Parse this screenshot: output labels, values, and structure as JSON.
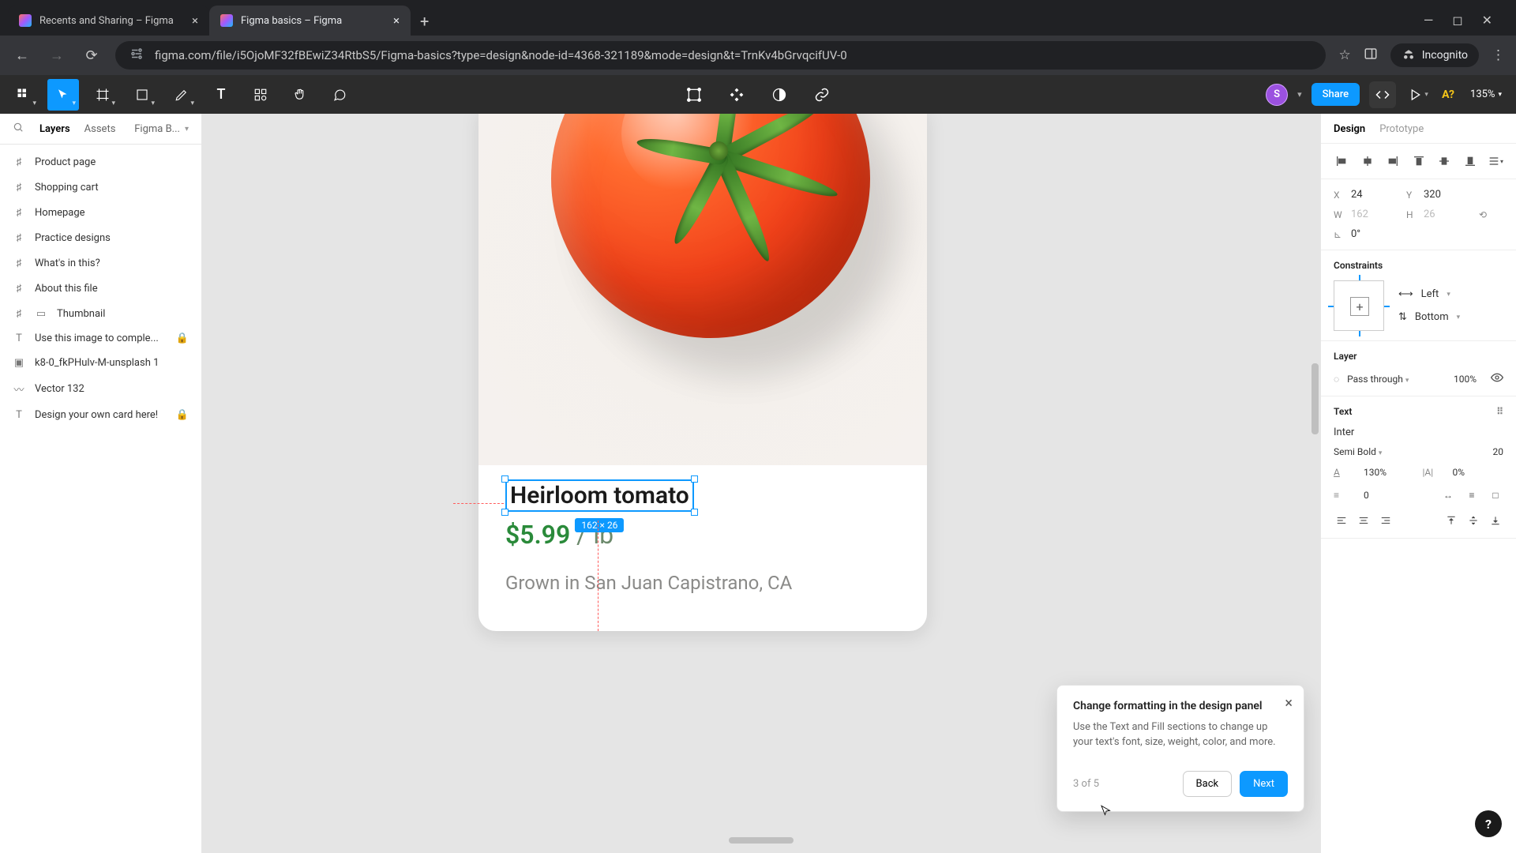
{
  "browser": {
    "tabs": [
      {
        "title": "Recents and Sharing – Figma",
        "active": false
      },
      {
        "title": "Figma basics – Figma",
        "active": true
      }
    ],
    "url": "figma.com/file/i5OjoMF32fBEwiZ34RtbS5/Figma-basics?type=design&node-id=4368-321189&mode=design&t=TrnKv4bGrvqcifUV-0",
    "incognito_label": "Incognito"
  },
  "toolbar": {
    "avatar_initial": "S",
    "share_label": "Share",
    "zoom": "135%"
  },
  "left_panel": {
    "header": {
      "layers": "Layers",
      "assets": "Assets",
      "page": "Figma B..."
    },
    "items": [
      {
        "icon": "frame-icon",
        "label": "Product page"
      },
      {
        "icon": "frame-icon",
        "label": "Shopping cart"
      },
      {
        "icon": "frame-icon",
        "label": "Homepage"
      },
      {
        "icon": "frame-icon",
        "label": "Practice designs"
      },
      {
        "icon": "frame-icon",
        "label": "What's in this?"
      },
      {
        "icon": "frame-icon",
        "label": "About this file"
      },
      {
        "icon": "frame-icon",
        "label": "Thumbnail",
        "thumb": true
      },
      {
        "icon": "text-icon",
        "label": "Use this image to comple...",
        "locked": true
      },
      {
        "icon": "image-icon",
        "label": "k8-0_fkPHulv-M-unsplash 1"
      },
      {
        "icon": "vector-icon",
        "label": "Vector 132"
      },
      {
        "icon": "text-icon",
        "label": "Design your own card here!",
        "locked": true
      }
    ]
  },
  "canvas": {
    "title": "Heirloom tomato",
    "price": "$5.99",
    "per": "/ lb",
    "origin": "Grown in San Juan Capistrano, CA",
    "selection_badge": "162 × 26"
  },
  "popover": {
    "title": "Change formatting in the design panel",
    "body": "Use the Text and Fill sections to change up your text's font, size, weight, color, and more.",
    "step": "3 of 5",
    "back": "Back",
    "next": "Next"
  },
  "right_panel": {
    "tabs": {
      "design": "Design",
      "prototype": "Prototype"
    },
    "position": {
      "x": "24",
      "y": "320",
      "w": "162",
      "h": "26",
      "rotation": "0°"
    },
    "constraints": {
      "header": "Constraints",
      "horiz": "Left",
      "vert": "Bottom"
    },
    "layer": {
      "header": "Layer",
      "mode": "Pass through",
      "opacity": "100%"
    },
    "text": {
      "header": "Text",
      "font": "Inter",
      "weight": "Semi Bold",
      "size": "20",
      "line_height": "130%",
      "letter_spacing": "0%",
      "paragraph": "0"
    }
  }
}
